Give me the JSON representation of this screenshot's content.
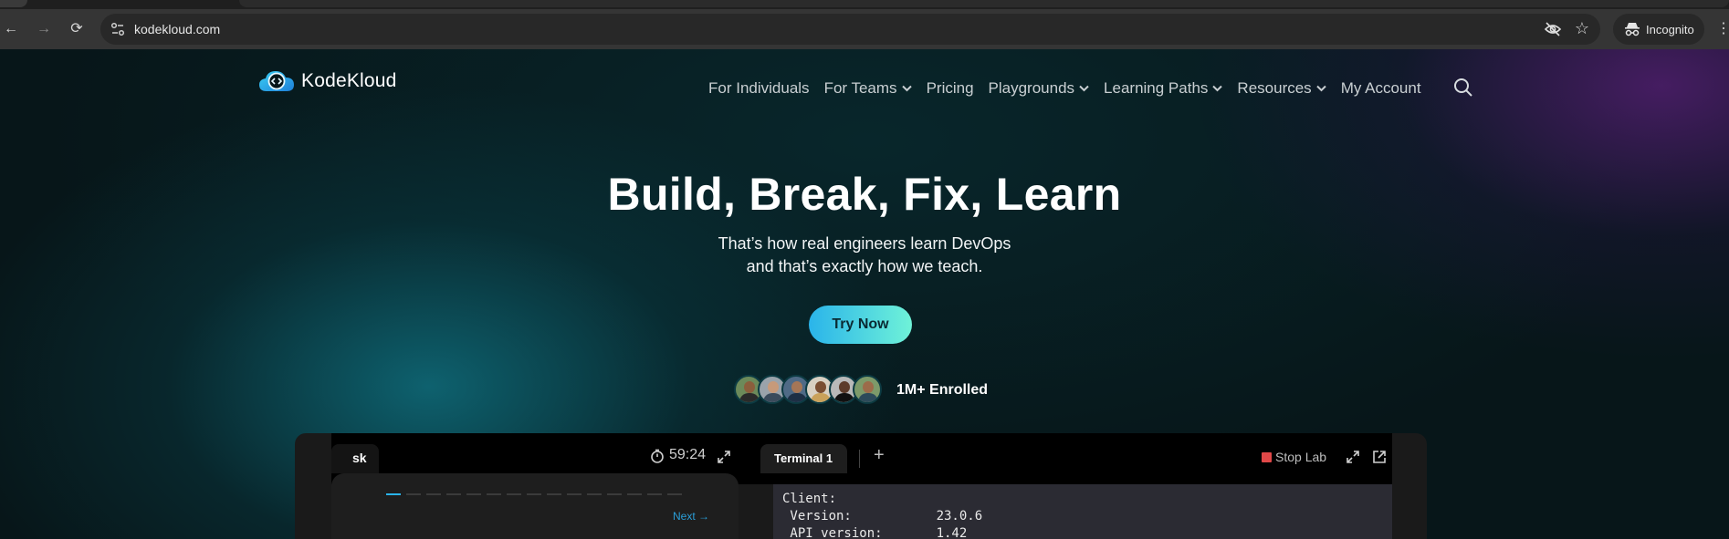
{
  "browser": {
    "url": "kodekloud.com",
    "incognito_label": "Incognito",
    "icons": [
      "back-icon",
      "forward-icon",
      "reload-icon",
      "site-info-icon",
      "eye-off-icon",
      "star-icon",
      "incognito-icon",
      "kebab-menu-icon"
    ]
  },
  "header": {
    "brand": "KodeKloud",
    "nav": [
      {
        "label": "For Individuals",
        "dropdown": false
      },
      {
        "label": "For Teams",
        "dropdown": true
      },
      {
        "label": "Pricing",
        "dropdown": false
      },
      {
        "label": "Playgrounds",
        "dropdown": true
      },
      {
        "label": "Learning Paths",
        "dropdown": true
      },
      {
        "label": "Resources",
        "dropdown": true
      },
      {
        "label": "My Account",
        "dropdown": false
      }
    ]
  },
  "hero": {
    "title": "Build, Break, Fix, Learn",
    "subtitle_line1": "That’s how real engineers learn DevOps",
    "subtitle_line2": "and that’s exactly how we teach.",
    "cta": "Try Now",
    "enrolled": "1M+ Enrolled"
  },
  "lab": {
    "task_tab": "sk",
    "timer": "59:24",
    "next": "Next →",
    "terminal_tab": "Terminal 1",
    "add_tab": "+",
    "stop": "Stop Lab",
    "terminal_lines": "Client:\n Version:           23.0.6\n API version:       1.42"
  },
  "colors": {
    "accent_cyan": "#2ab4ea",
    "accent_mint": "#6ff2d8",
    "stop_red": "#e04848"
  }
}
